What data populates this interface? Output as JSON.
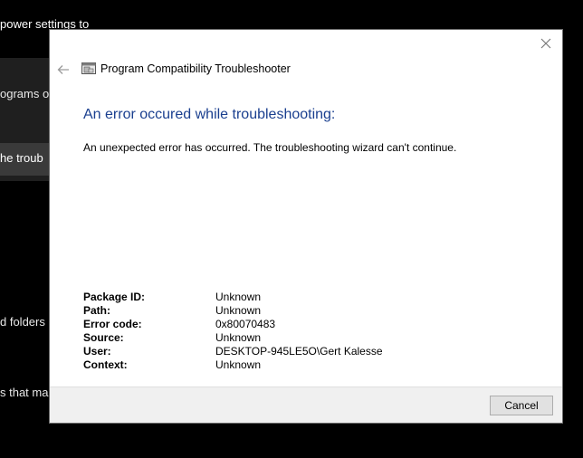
{
  "background": {
    "fragments": [
      "power settings to",
      "ograms o",
      "he troub",
      "d folders",
      "s that ma"
    ]
  },
  "dialog": {
    "title": "Program Compatibility Troubleshooter",
    "heading": "An error occured while troubleshooting:",
    "message": "An unexpected error has occurred. The troubleshooting wizard can't continue.",
    "details": [
      {
        "label": "Package ID:",
        "value": "Unknown"
      },
      {
        "label": "Path:",
        "value": "Unknown"
      },
      {
        "label": "Error code:",
        "value": "0x80070483"
      },
      {
        "label": "Source:",
        "value": "Unknown"
      },
      {
        "label": "User:",
        "value": "DESKTOP-945LE5O\\Gert Kalesse"
      },
      {
        "label": "Context:",
        "value": "Unknown"
      }
    ],
    "cancel_label": "Cancel",
    "icons": {
      "close": "close-icon",
      "back": "back-arrow-icon",
      "app": "troubleshooter-icon"
    },
    "colors": {
      "heading": "#1a3f8f",
      "footer": "#f0f0f0"
    }
  }
}
